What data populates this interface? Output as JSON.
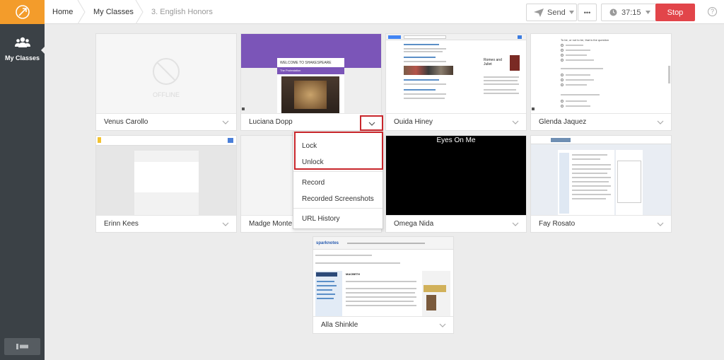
{
  "sidebar": {
    "nav_label": "My Classes",
    "colors": {
      "logo_bg": "#f39c2b",
      "sidebar_bg": "#3b4146"
    }
  },
  "breadcrumb": {
    "home": "Home",
    "classes": "My Classes",
    "current": "3. English Honors"
  },
  "toolbar": {
    "send_label": "Send",
    "more_label": "•••",
    "timer_value": "37:15",
    "stop_label": "Stop",
    "help_label": "?",
    "stop_color": "#e2454a"
  },
  "students": [
    {
      "name": "Venus Carollo",
      "status": "OFFLINE"
    },
    {
      "name": "Luciana Dopp",
      "screen_heading": "WELCOME TO SHAKESPEARE",
      "screen_sub": "The Protestation"
    },
    {
      "name": "Ouida Hiney",
      "screen_heading": "Romeo and Juliet"
    },
    {
      "name": "Glenda Jaquez",
      "screen_heading": "To be, or not to be, that is the question"
    },
    {
      "name": "Erinn Kees"
    },
    {
      "name": "Madge Monte"
    },
    {
      "name": "Omega Nida",
      "screen_heading": "Eyes On Me"
    },
    {
      "name": "Fay Rosato"
    },
    {
      "name": "Alla Shinkle",
      "screen_heading": "sparknotes",
      "screen_sub": "MACBETH"
    }
  ],
  "dropdown": {
    "items": [
      "Lock",
      "Unlock",
      "Record",
      "Recorded Screenshots",
      "URL History"
    ],
    "highlight_color": "#c8262b"
  }
}
